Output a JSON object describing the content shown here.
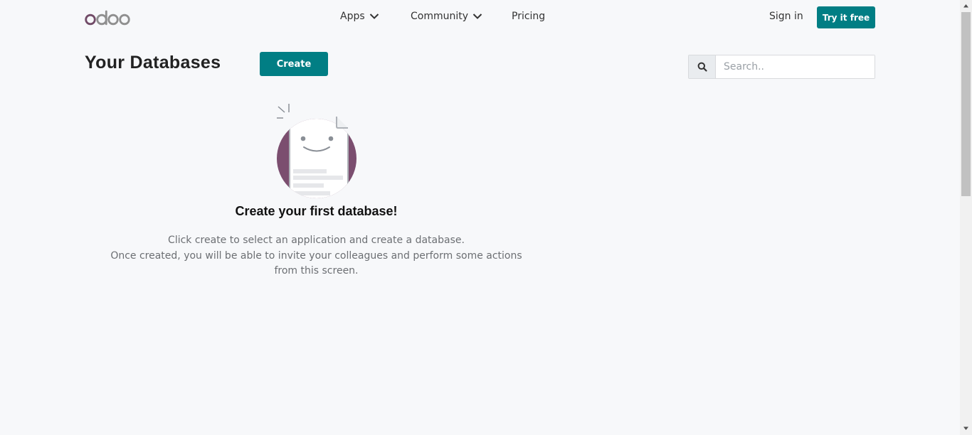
{
  "header": {
    "logo_text": "odoo",
    "nav": [
      {
        "label": "Apps"
      },
      {
        "label": "Community"
      },
      {
        "label": "Pricing"
      }
    ],
    "sign_in_label": "Sign in",
    "try_label": "Try it free"
  },
  "main": {
    "title": "Your Databases",
    "create_label": "Create",
    "search_placeholder": "Search..",
    "empty_title": "Create your first database!",
    "empty_line1": "Click create to select an application and create a database.",
    "empty_line2": "Once created, you will be able to invite your colleagues and perform some actions from this screen."
  },
  "icons": {
    "search": "search-icon",
    "chevron": "chevron-down-icon",
    "illustration": "empty-document-icon"
  },
  "colors": {
    "brand": "#714b67",
    "accent": "#017e84",
    "background": "#f7f8fa"
  }
}
